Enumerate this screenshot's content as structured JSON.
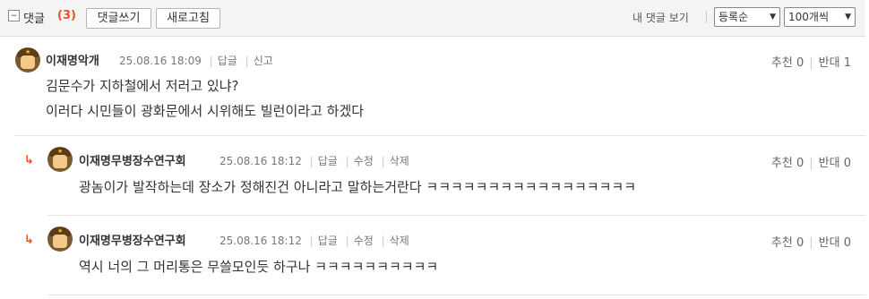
{
  "toolbar": {
    "toggle_icon": "minus-square-icon",
    "title": "댓글",
    "count": "(3)",
    "write_label": "댓글쓰기",
    "refresh_label": "새로고침",
    "my_comments_label": "내 댓글 보기",
    "sort_value": "등록순",
    "page_size_value": "100개씩"
  },
  "comments": [
    {
      "author": "이재명악개",
      "date": "25.08.16 18:09",
      "actions": [
        "답글",
        "신고"
      ],
      "recommend_label": "추천",
      "recommend_count": "0",
      "oppose_label": "반대",
      "oppose_count": "1",
      "lines": [
        "김문수가 지하철에서 저러고 있냐?",
        "이러다 시민들이 광화문에서 시위해도 빌런이라고 하겠다"
      ]
    },
    {
      "author": "이재명무병장수연구회",
      "date": "25.08.16 18:12",
      "actions": [
        "답글",
        "수정",
        "삭제"
      ],
      "recommend_label": "추천",
      "recommend_count": "0",
      "oppose_label": "반대",
      "oppose_count": "0",
      "lines": [
        "광놈이가 발작하는데 장소가 정해진건 아니라고 말하는거란다 ㅋㅋㅋㅋㅋㅋㅋㅋㅋㅋㅋㅋㅋㅋㅋㅋㅋ"
      ]
    },
    {
      "author": "이재명무병장수연구회",
      "date": "25.08.16 18:12",
      "actions": [
        "답글",
        "수정",
        "삭제"
      ],
      "recommend_label": "추천",
      "recommend_count": "0",
      "oppose_label": "반대",
      "oppose_count": "0",
      "lines": [
        "역시 너의 그 머리통은 무쓸모인듯 하구나 ㅋㅋㅋㅋㅋㅋㅋㅋㅋㅋ"
      ]
    }
  ],
  "colors": {
    "accent": "#e8541d",
    "toolbar_bg": "#f4f4f4"
  }
}
